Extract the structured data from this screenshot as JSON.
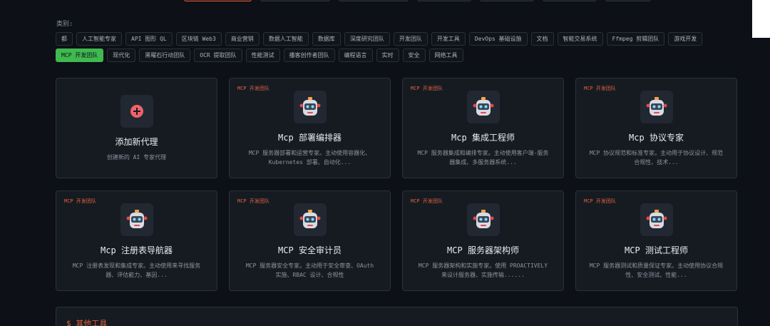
{
  "category_label": "类别:",
  "tags": [
    {
      "label": "都",
      "active": false
    },
    {
      "label": "人工智能专家",
      "active": false
    },
    {
      "label": "API 图形 QL",
      "active": false
    },
    {
      "label": "区块链 Web3",
      "active": false
    },
    {
      "label": "商业营销",
      "active": false
    },
    {
      "label": "数据人工智能",
      "active": false
    },
    {
      "label": "数据库",
      "active": false
    },
    {
      "label": "深度研究团队",
      "active": false
    },
    {
      "label": "开发团队",
      "active": false
    },
    {
      "label": "开发工具",
      "active": false
    },
    {
      "label": "DevOps 基础设施",
      "active": false
    },
    {
      "label": "文档",
      "active": false
    },
    {
      "label": "智能交易系统",
      "active": false
    },
    {
      "label": "Ffmpeg 剪辑团队",
      "active": false
    },
    {
      "label": "游戏开发",
      "active": false
    },
    {
      "label": "MCP 开发团队",
      "active": true
    },
    {
      "label": "现代化",
      "active": false
    },
    {
      "label": "黑曜石行动团队",
      "active": false
    },
    {
      "label": "OCR 提取团队",
      "active": false
    },
    {
      "label": "性能测试",
      "active": false
    },
    {
      "label": "播客创作者团队",
      "active": false
    },
    {
      "label": "编程语言",
      "active": false
    },
    {
      "label": "实时",
      "active": false
    },
    {
      "label": "安全",
      "active": false
    },
    {
      "label": "网络工具",
      "active": false
    }
  ],
  "add_card": {
    "title": "添加新代理",
    "desc": "创建新的 AI 专家代理"
  },
  "agents": [
    {
      "badge": "MCP 开发团队",
      "title": "Mcp 部署编排器",
      "desc": "MCP 服务器部署和运营专家。主动使用容器化、Kubernetes 部署、自动化..."
    },
    {
      "badge": "MCP 开发团队",
      "title": "Mcp 集成工程师",
      "desc": "MCP 服务器集成和编排专家。主动使用客户端-服务器集成、多服务器系统..."
    },
    {
      "badge": "MCP 开发团队",
      "title": "Mcp 协议专家",
      "desc": "MCP 协议规范和标准专家。主动用于协议设计、规范合规性、技术..."
    },
    {
      "badge": "MCP 开发团队",
      "title": "Mcp 注册表导航器",
      "desc": "MCP 注册表发现和集成专家。主动使用来寻找服务器、评估能力、基因..."
    },
    {
      "badge": "MCP 开发团队",
      "title": "MCP 安全审计员",
      "desc": "MCP 服务器安全专家。主动用于安全审查、OAuth 实施、RBAC 设计、合规性"
    },
    {
      "badge": "MCP 开发团队",
      "title": "MCP 服务器架构师",
      "desc": "MCP 服务器架构和实施专家。使用 PROACTIVELY 来设计服务器、实施传输......"
    },
    {
      "badge": "MCP 开发团队",
      "title": "MCP 测试工程师",
      "desc": "MCP 服务器测试和质量保证专家。主动使用协议合规性、安全测试、性能..."
    }
  ],
  "other_tools": {
    "title": "$ 其他工具"
  },
  "colors": {
    "accent": "#e0603d",
    "active_tag": "#3fb950",
    "bg": "#0d1017",
    "card": "#161b22"
  },
  "icons": {
    "add": "plus-circle-icon",
    "agent": "robot-icon"
  }
}
